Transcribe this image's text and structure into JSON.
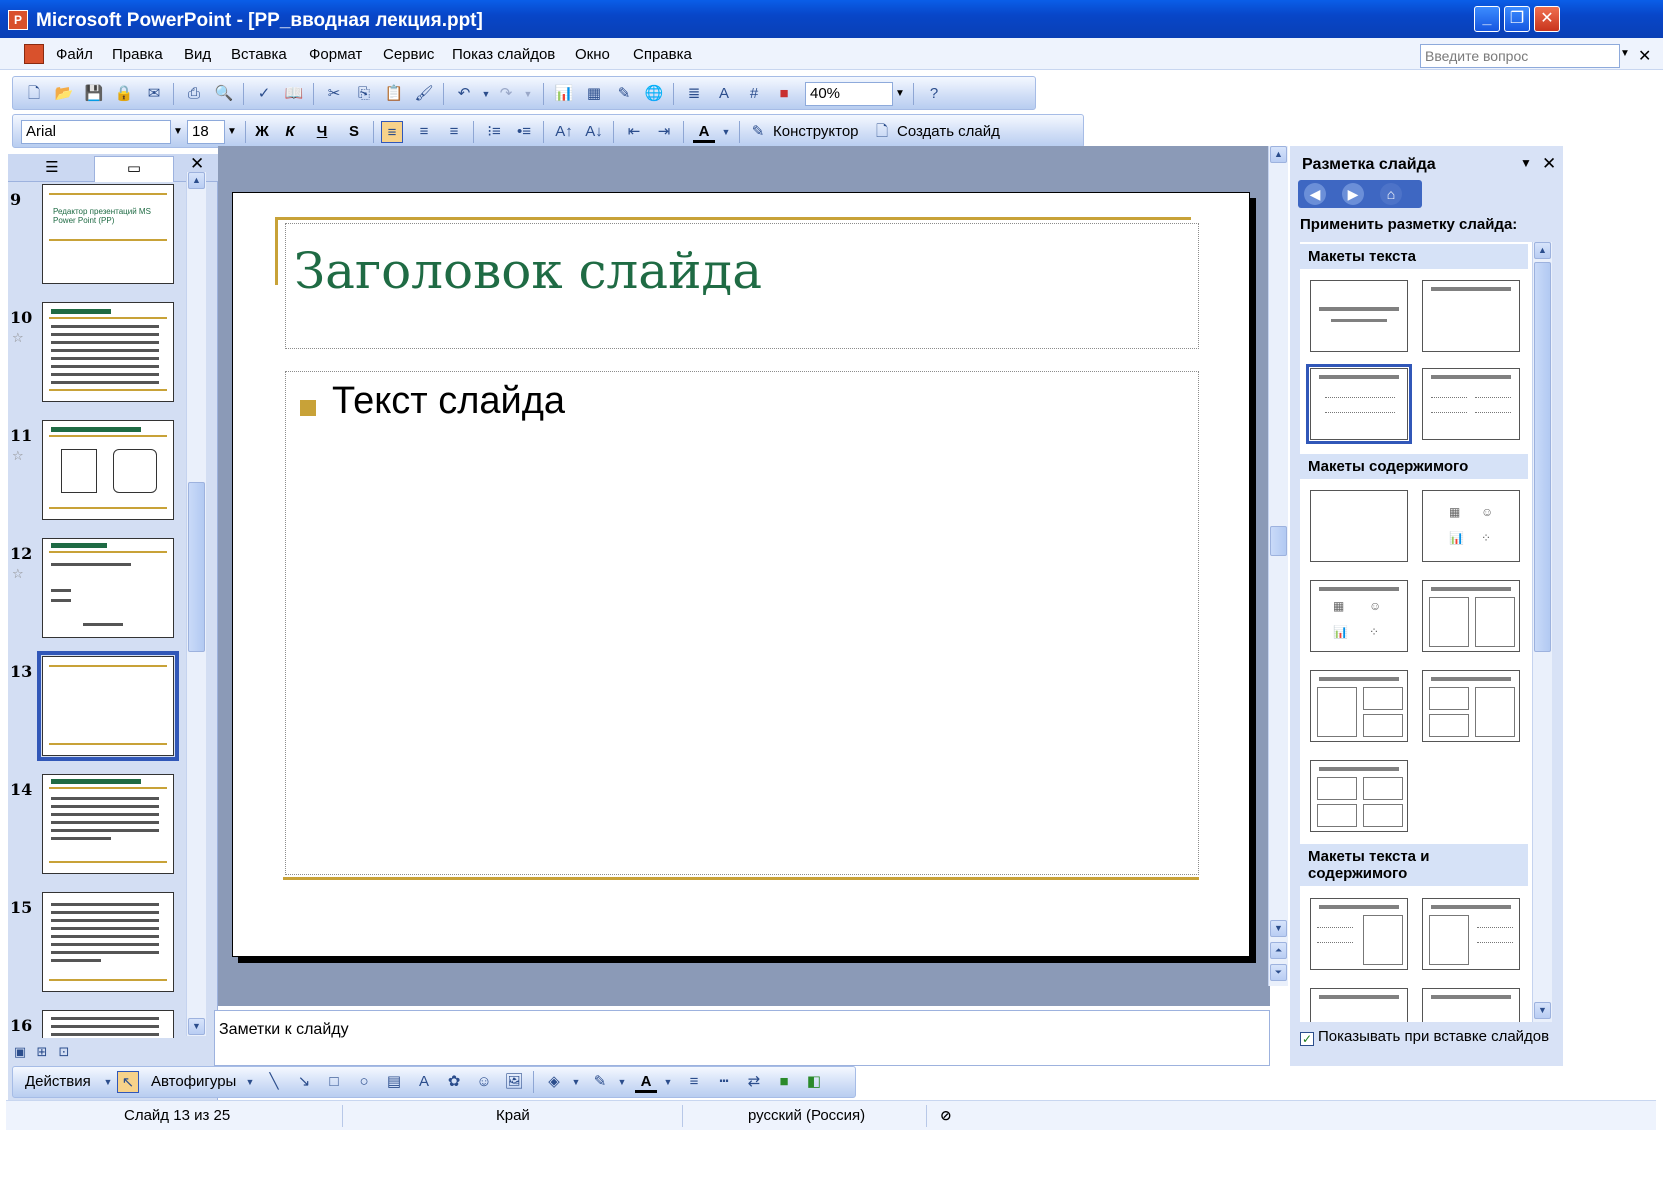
{
  "window": {
    "title": "Microsoft PowerPoint - [PP_вводная лекция.ppt]"
  },
  "menu": {
    "items": [
      "Файл",
      "Правка",
      "Вид",
      "Вставка",
      "Формат",
      "Сервис",
      "Показ слайдов",
      "Окно",
      "Справка"
    ],
    "help_placeholder": "Введите вопрос"
  },
  "toolbar_standard": {
    "zoom": "40%"
  },
  "toolbar_formatting": {
    "font": "Arial",
    "size": "18",
    "bold": "Ж",
    "italic": "К",
    "underline": "Ч",
    "shadow": "S",
    "designer": "Конструктор",
    "new_slide": "Создать слайд"
  },
  "slides_pane": {
    "thumbnails": [
      {
        "num": "9",
        "title": "Редактор презентаций MS Power Point (PP)",
        "has_star": false
      },
      {
        "num": "10",
        "title": "Возможности PP",
        "has_star": true
      },
      {
        "num": "11",
        "title": "Этапы создания презентации",
        "has_star": true
      },
      {
        "num": "12",
        "title": "Окно программы",
        "has_star": true
      },
      {
        "num": "13",
        "title": "",
        "has_star": false,
        "selected": true
      },
      {
        "num": "14",
        "title": "Основные операции со слайдами",
        "has_star": false
      },
      {
        "num": "15",
        "title": "",
        "has_star": false
      },
      {
        "num": "16",
        "title": "",
        "has_star": false
      }
    ]
  },
  "slide": {
    "title": "Заголовок слайда",
    "body": "Текст слайда"
  },
  "notes": {
    "placeholder": "Заметки к слайду"
  },
  "taskpane": {
    "title": "Разметка слайда",
    "apply_label": "Применить разметку слайда:",
    "sections": {
      "text_layouts": "Макеты текста",
      "content_layouts": "Макеты содержимого",
      "text_content_layouts": "Макеты текста и содержимого"
    },
    "show_on_insert": "Показывать при вставке слайдов",
    "show_on_insert_checked": true
  },
  "toolbar_drawing": {
    "actions": "Действия",
    "autoshapes": "Автофигуры"
  },
  "statusbar": {
    "slide_position": "Слайд 13 из 25",
    "design": "Край",
    "language": "русский (Россия)"
  },
  "colors": {
    "title_green": "#1f6b44",
    "accent_gold": "#c8a238",
    "xp_blue": "#0a3fb5"
  }
}
